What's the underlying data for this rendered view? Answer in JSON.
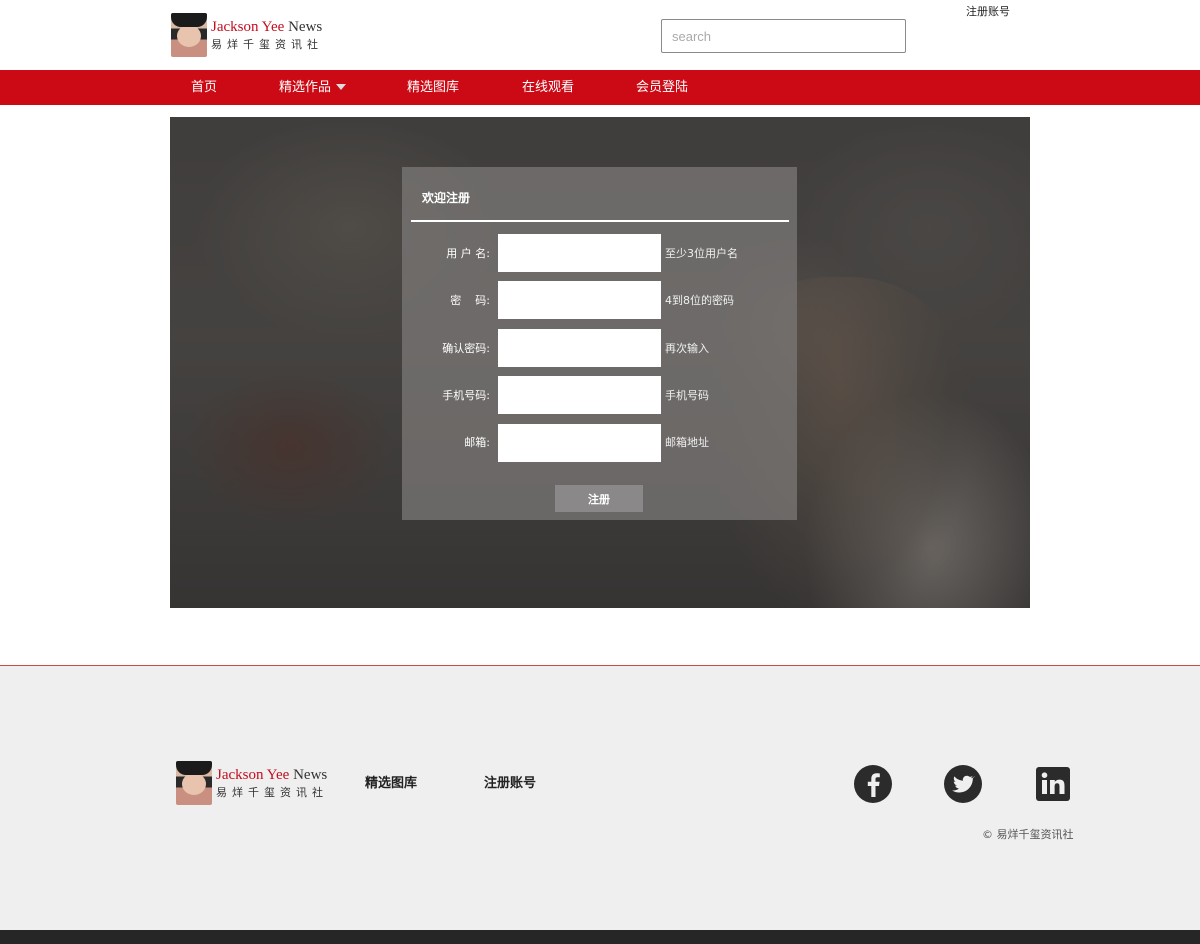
{
  "header": {
    "brand_name": "Jackson Yee",
    "brand_suffix": "News",
    "brand_sub": "易烊千玺资讯社",
    "search_placeholder": "search",
    "register_link": "注册账号"
  },
  "nav": {
    "items": [
      {
        "label": "首页"
      },
      {
        "label": "精选作品",
        "has_dropdown": true
      },
      {
        "label": "精选图库"
      },
      {
        "label": "在线观看"
      },
      {
        "label": "会员登陆"
      }
    ],
    "bg_color": "#cc0a16"
  },
  "form": {
    "title": "欢迎注册",
    "fields": [
      {
        "label": "用 户 名:",
        "hint": "至少3位用户名"
      },
      {
        "label": "密    码:",
        "hint": "4到8位的密码"
      },
      {
        "label": "确认密码:",
        "hint": "再次输入"
      },
      {
        "label": "手机号码:",
        "hint": "手机号码"
      },
      {
        "label": "邮箱:",
        "hint": "邮箱地址"
      }
    ],
    "submit_label": "注册"
  },
  "footer": {
    "brand_name": "Jackson Yee",
    "brand_suffix": "News",
    "brand_sub": "易烊千玺资讯社",
    "links": [
      {
        "label": "精选图库"
      },
      {
        "label": "注册账号"
      }
    ],
    "social": [
      {
        "icon": "facebook-icon"
      },
      {
        "icon": "twitter-icon"
      },
      {
        "icon": "linkedin-icon"
      }
    ],
    "copyright": "© 易烊千玺资讯社"
  }
}
